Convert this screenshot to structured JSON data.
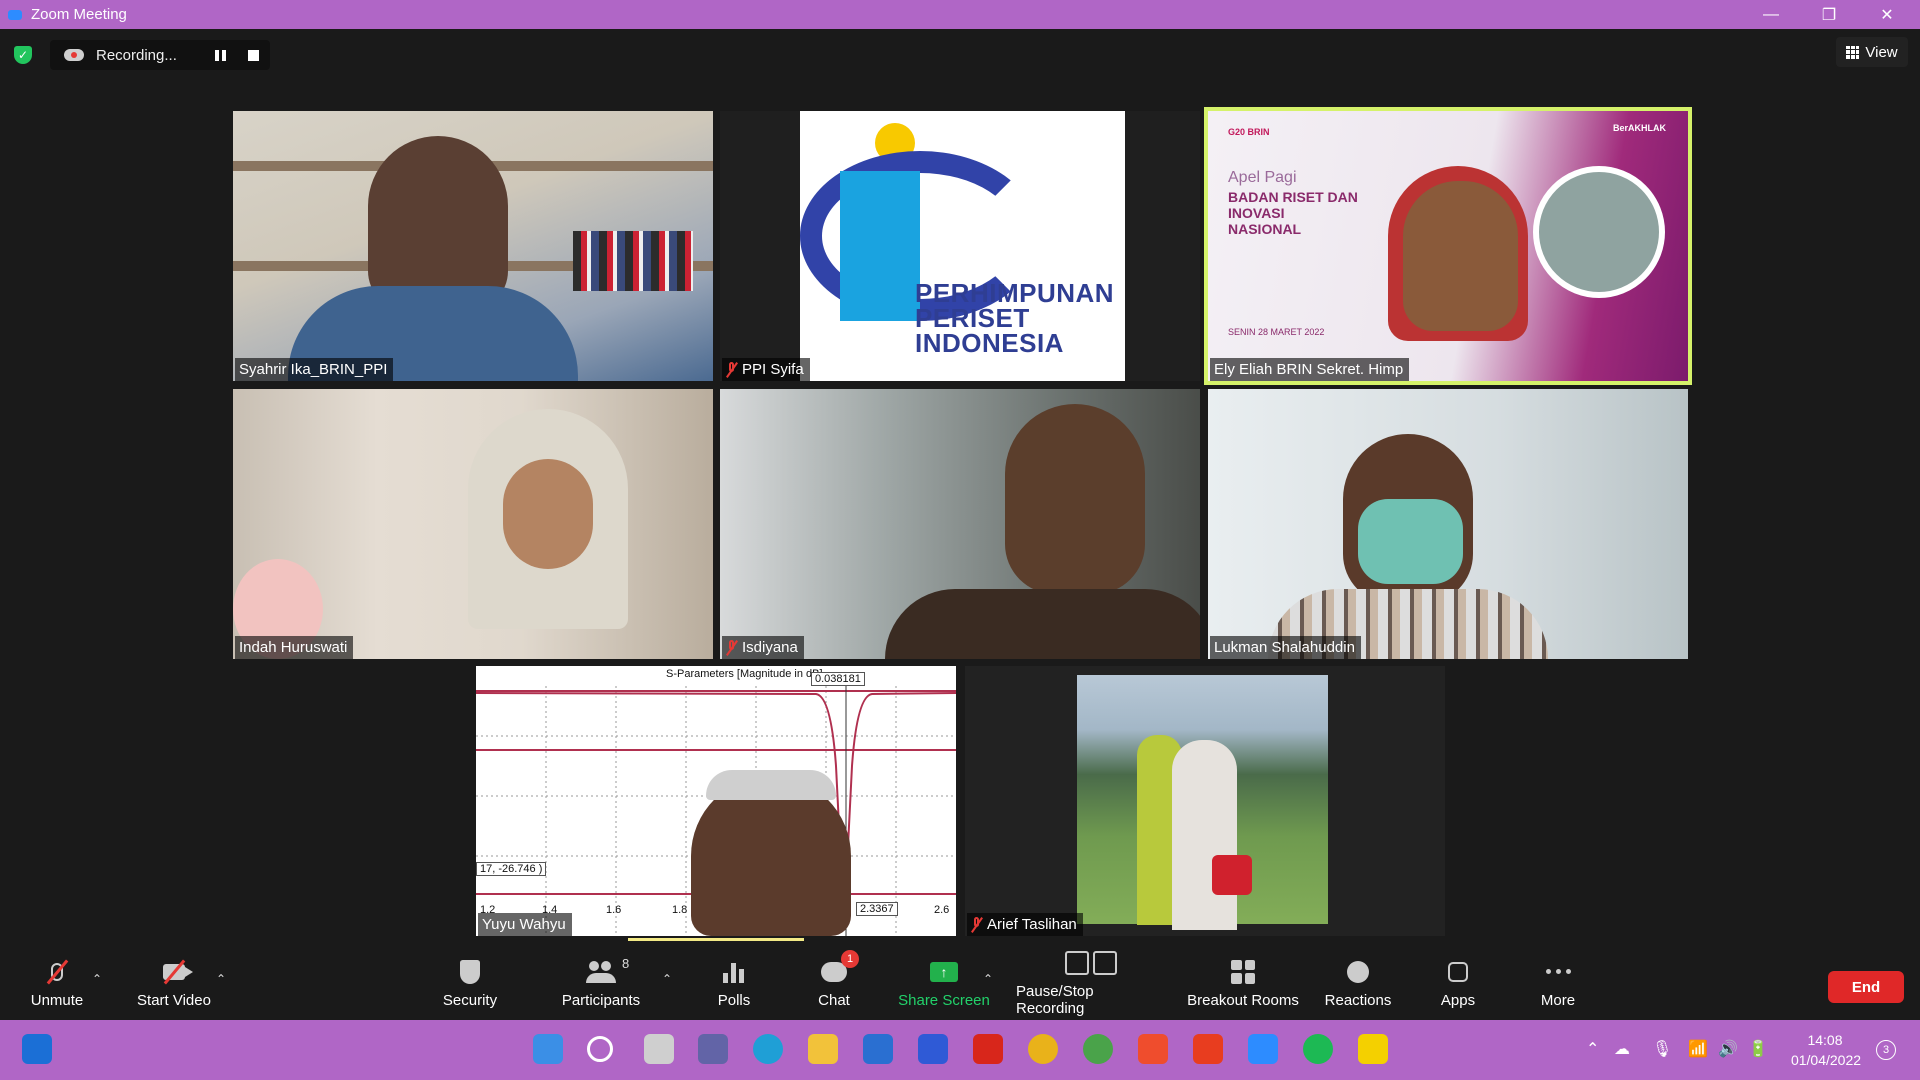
{
  "window": {
    "title": "Zoom Meeting",
    "controls": {
      "minimize": "—",
      "maximize": "❐",
      "close": "✕"
    }
  },
  "topbar": {
    "recording_label": "Recording...",
    "view_label": "View"
  },
  "tiles": {
    "t1": {
      "name": "Syahrir Ika_BRIN_PPI"
    },
    "t2": {
      "name": "PPI Syifa",
      "logo_lines": [
        "PERHIMPUNAN",
        "PERISET",
        "INDONESIA"
      ]
    },
    "t3": {
      "name": "Ely Eliah BRIN Sekret. Himp",
      "slide_subtitle": "Apel Pagi",
      "slide_heading": "BADAN RISET DAN INOVASI NASIONAL",
      "slide_date": "SENIN 28 MARET 2022",
      "slide_org": "G20  BRIN",
      "slide_brand": "BerAKHLAK"
    },
    "t4": {
      "name": "Indah Huruswati"
    },
    "t5": {
      "name": "Isdiyana"
    },
    "t6": {
      "name": "Lukman Shalahuddin"
    },
    "t7": {
      "name": "Yuyu Wahyu",
      "chart_title": "S-Parameters [Magnitude in dB]",
      "marker_label": "0.038181",
      "marker_x_label": "2.3367",
      "y_readout": "17, -26.746 )",
      "x_ticks": [
        "1.2",
        "1.4",
        "1.6",
        "1.8",
        "2.6"
      ]
    },
    "t8": {
      "name": "Arief Taslihan"
    }
  },
  "toolbar": {
    "unmute": "Unmute",
    "start_video": "Start Video",
    "security": "Security",
    "participants": "Participants",
    "participants_count": "8",
    "polls": "Polls",
    "chat": "Chat",
    "chat_badge": "1",
    "share_screen": "Share Screen",
    "pause_stop_recording": "Pause/Stop Recording",
    "breakout_rooms": "Breakout Rooms",
    "reactions": "Reactions",
    "apps": "Apps",
    "more": "More",
    "end": "End"
  },
  "taskbar": {
    "time": "14:08",
    "date": "01/04/2022",
    "notifications": "3"
  },
  "colors": {
    "titlebar": "#b066c6",
    "share_green": "#22b14c",
    "end_red": "#e02828",
    "active_speaker": "#d5f26a"
  }
}
